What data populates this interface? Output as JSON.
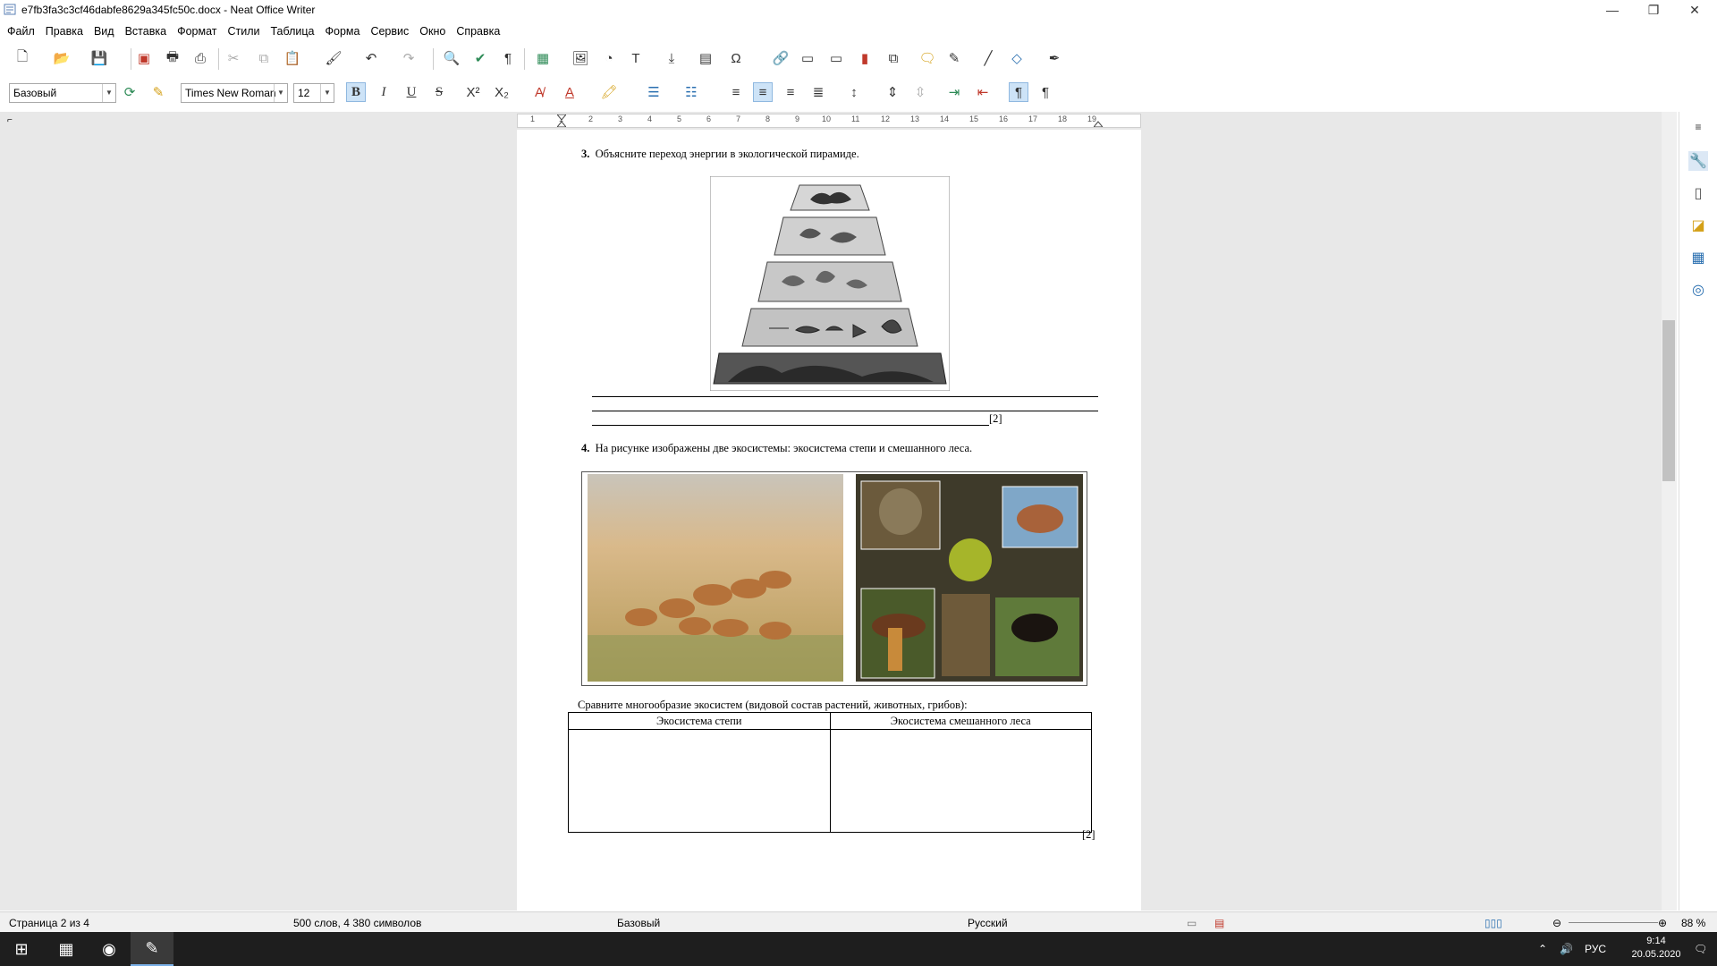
{
  "window": {
    "title": "e7fb3fa3c3cf46dabfe8629a345fc50c.docx - Neat Office Writer",
    "controls": [
      "—",
      "❐",
      "✕"
    ]
  },
  "menu": [
    "Файл",
    "Правка",
    "Вид",
    "Вставка",
    "Формат",
    "Стили",
    "Таблица",
    "Форма",
    "Сервис",
    "Окно",
    "Справка"
  ],
  "formatting": {
    "paragraph_style": "Базовый",
    "font_name": "Times New Roman",
    "font_size": "12",
    "bold": "B",
    "italic": "I",
    "underline": "U",
    "strike": "S"
  },
  "ruler": {
    "ticks": [
      "1",
      "1",
      "2",
      "3",
      "4",
      "5",
      "6",
      "7",
      "8",
      "9",
      "10",
      "11",
      "12",
      "13",
      "14",
      "15",
      "16",
      "17",
      "18",
      "19"
    ]
  },
  "document": {
    "q3": {
      "number": "3.",
      "text": "Объясните переход энергии в экологической пирамиде.",
      "score": "[2]"
    },
    "q4": {
      "number": "4.",
      "text": "На рисунке изображены две экосистемы: экосистема степи и смешанного леса.",
      "compare_text": "Сравните многообразие экосистем (видовой состав растений, животных, грибов):",
      "table_headers": [
        "Экосистема степи",
        "Экосистема смешанного леса"
      ],
      "score": "[2]"
    }
  },
  "status": {
    "page": "Страница 2 из 4",
    "words": "500 слов, 4 380 символов",
    "style": "Базовый",
    "language": "Русский",
    "zoom": "88 %"
  },
  "taskbar": {
    "lang": "РУС",
    "time": "9:14",
    "date": "20.05.2020"
  }
}
